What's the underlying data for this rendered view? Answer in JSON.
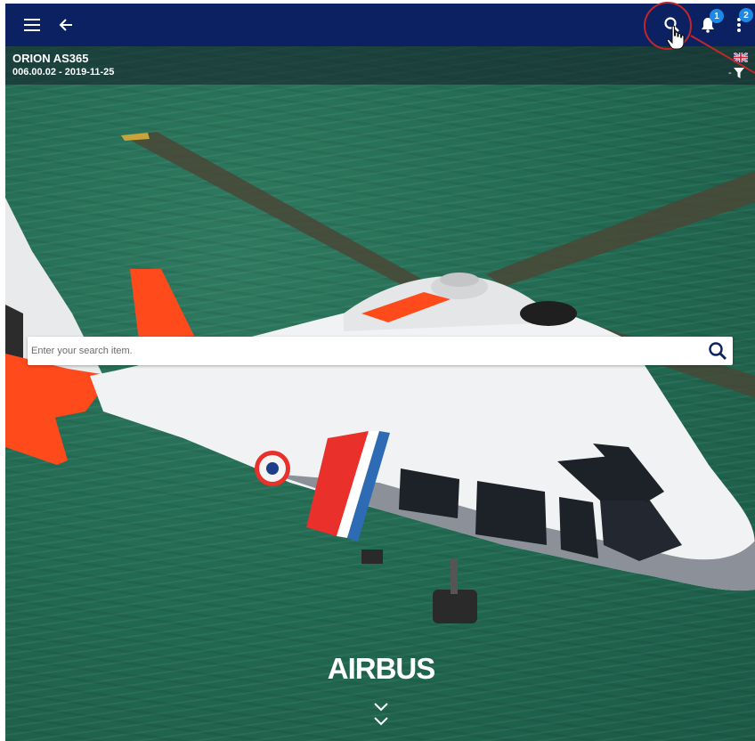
{
  "topbar": {
    "menu_icon": "menu-icon",
    "back_icon": "arrow-left-icon",
    "search_icon": "search-icon",
    "notifications_icon": "bell-icon",
    "notifications_count": "1",
    "more_icon": "more-vertical-icon",
    "more_count": "2",
    "background_color": "#0b2161",
    "badge_color": "#1e88e5"
  },
  "info": {
    "model": "ORION AS365",
    "version": "006.00.02 - 2019-11-25",
    "language_icon": "uk-flag-icon",
    "filter_prefix": "-",
    "filter_icon": "filter-icon"
  },
  "search": {
    "placeholder": "Enter your search item.",
    "submit_icon": "search-icon"
  },
  "hero": {
    "brand": "AIRBUS",
    "scroll_icon": "double-chevron-down-icon"
  },
  "annotation": {
    "highlight_color": "#c0272d",
    "cursor_icon": "hand-pointer-icon"
  }
}
